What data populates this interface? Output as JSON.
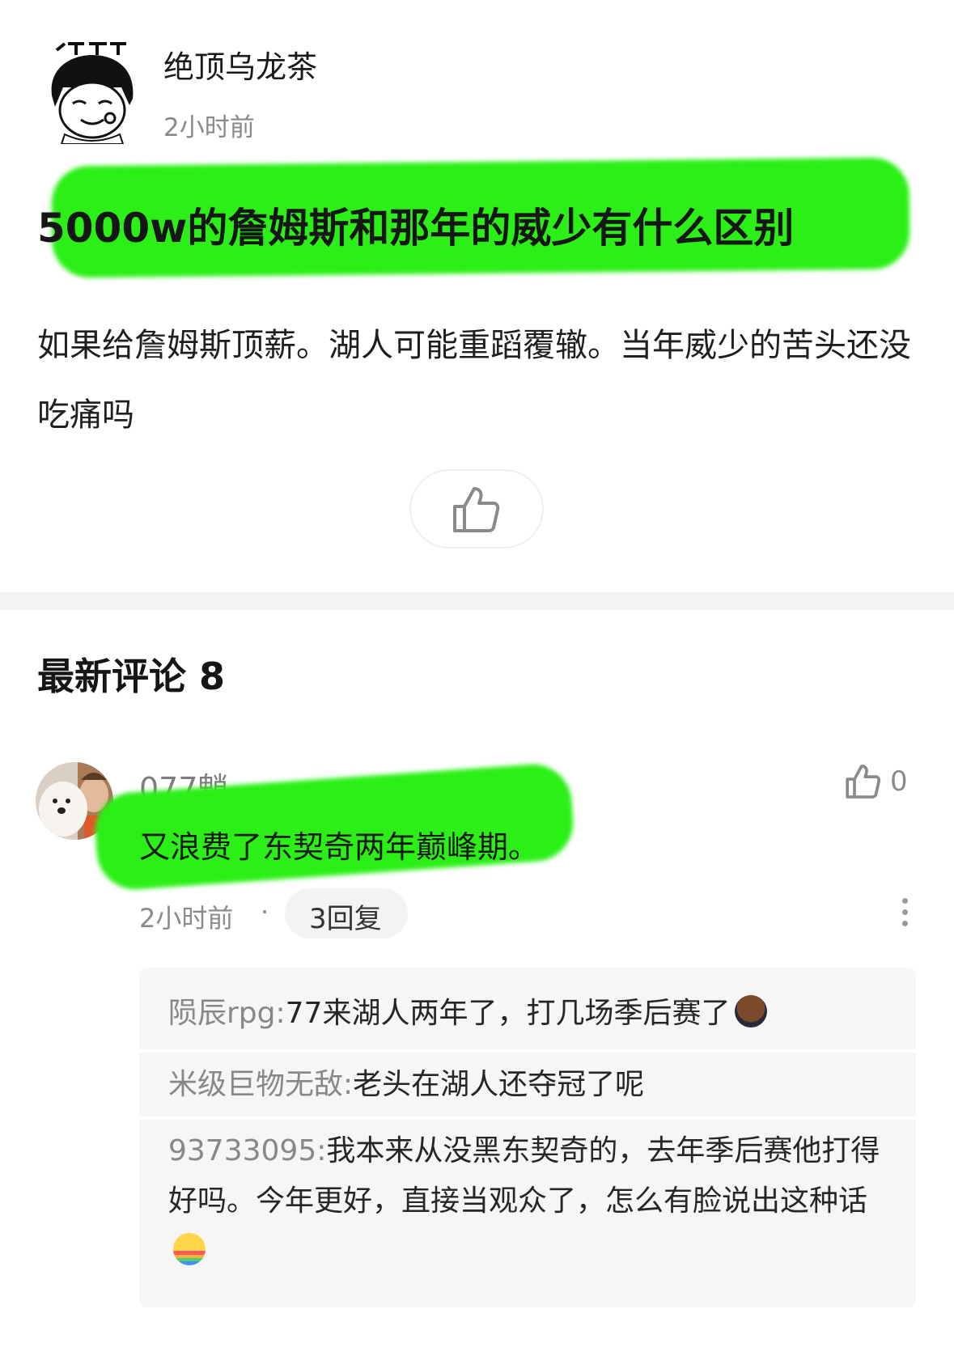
{
  "post": {
    "author": "绝顶乌龙茶",
    "time": "2小时前",
    "title": "5000w的詹姆斯和那年的威少有什么区别",
    "body": "如果给詹姆斯顶薪。湖人可能重蹈覆辙。当年威少的苦头还没吃痛吗",
    "avatar_icon": "meme-avatar-icon",
    "like_icon": "thumb-up-icon"
  },
  "comments_section": {
    "title": "最新评论 8"
  },
  "comment": {
    "user": "077魈",
    "text": "又浪费了东契奇两年巅峰期。",
    "time": "2小时前",
    "dot": "·",
    "reply_count": "3回复",
    "likes": "0"
  },
  "replies": [
    {
      "user": "陨辰rpg",
      "sep": ":",
      "text": "77来湖人两年了，打几场季后赛了",
      "emoji": "crying-face-emoji"
    },
    {
      "user": "米级巨物无敌",
      "sep": ":",
      "text": "老头在湖人还夺冠了呢"
    },
    {
      "user": "93733095",
      "sep": ":",
      "text": "我本来从没黑东契奇的，去年季后赛他打得好吗。今年更好，直接当观众了，怎么有脸说出这种话",
      "emoji": "rainbow-vomit-emoji"
    }
  ],
  "colors": {
    "highlight": "#2bef17",
    "muted": "#8a8a8a",
    "reply_bg": "#f6f6f6"
  }
}
